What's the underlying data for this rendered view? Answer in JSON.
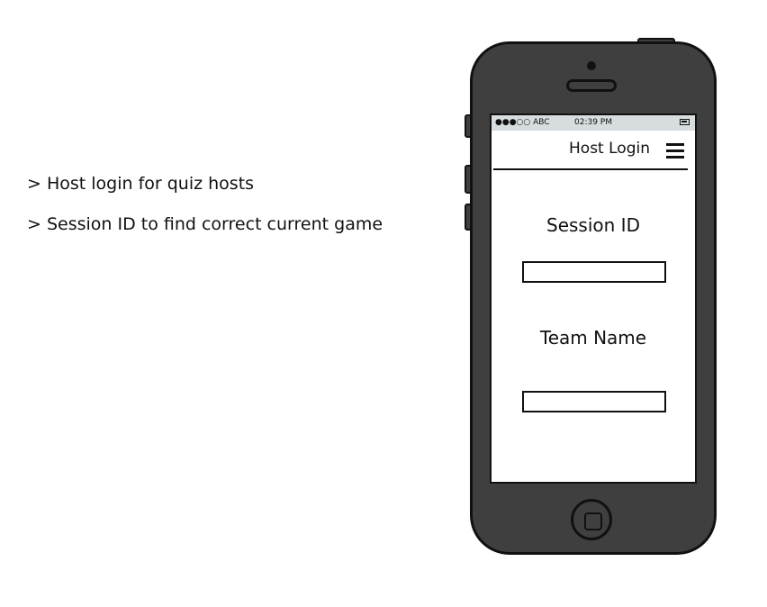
{
  "notes": [
    "> Host login for quiz hosts",
    "> Session ID to find correct current game"
  ],
  "status_bar": {
    "carrier": "●●●○○ ABC",
    "time": "02:39 PM"
  },
  "header": {
    "title": "Host Login"
  },
  "form": {
    "session_label": "Session ID",
    "session_value": "",
    "team_label": "Team Name",
    "team_value": ""
  }
}
